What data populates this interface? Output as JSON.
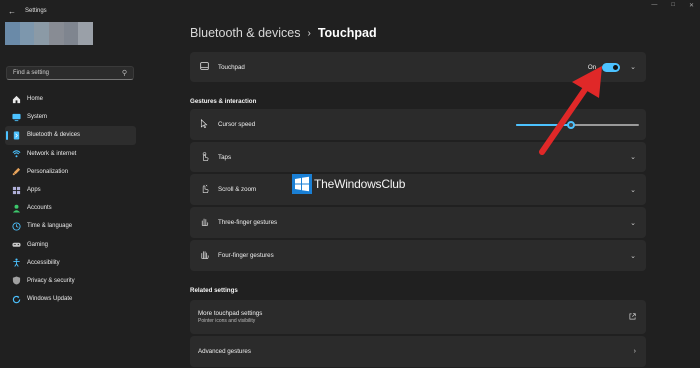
{
  "app": {
    "title": "Settings",
    "back_icon": "arrow-left-icon",
    "window_controls": [
      "minimize-icon",
      "maximize-icon",
      "close-icon"
    ]
  },
  "search": {
    "placeholder": "Find a setting",
    "icon": "search-icon"
  },
  "sidebar": {
    "items": [
      {
        "label": "Home",
        "icon": "home-icon",
        "active": false,
        "color": "#e8e8e8"
      },
      {
        "label": "System",
        "icon": "monitor-icon",
        "active": false,
        "color": "#4cc2ff"
      },
      {
        "label": "Bluetooth & devices",
        "icon": "bluetooth-icon",
        "active": true,
        "color": "#4cc2ff"
      },
      {
        "label": "Network & internet",
        "icon": "wifi-icon",
        "active": false,
        "color": "#4cc2ff"
      },
      {
        "label": "Personalization",
        "icon": "brush-icon",
        "active": false,
        "color": "#e8a45c"
      },
      {
        "label": "Apps",
        "icon": "apps-icon",
        "active": false,
        "color": "#b0b0d8"
      },
      {
        "label": "Accounts",
        "icon": "person-icon",
        "active": false,
        "color": "#3cc86c"
      },
      {
        "label": "Time & language",
        "icon": "globe-clock-icon",
        "active": false,
        "color": "#4cc2ff"
      },
      {
        "label": "Gaming",
        "icon": "gamepad-icon",
        "active": false,
        "color": "#c8c8c8"
      },
      {
        "label": "Accessibility",
        "icon": "accessibility-icon",
        "active": false,
        "color": "#4cc2ff"
      },
      {
        "label": "Privacy & security",
        "icon": "shield-icon",
        "active": false,
        "color": "#a0a0a0"
      },
      {
        "label": "Windows Update",
        "icon": "refresh-icon",
        "active": false,
        "color": "#4cc2ff"
      }
    ]
  },
  "breadcrumb": {
    "parent": "Bluetooth & devices",
    "separator": "›",
    "current": "Touchpad"
  },
  "touchpad": {
    "label": "Touchpad",
    "icon": "touchpad-icon",
    "state": "On",
    "enabled": true
  },
  "gestures_section": {
    "heading": "Gestures & interaction",
    "cursor_speed": {
      "label": "Cursor speed",
      "icon": "cursor-icon",
      "value_fraction": 0.45
    },
    "rows": [
      {
        "label": "Taps",
        "icon": "tap-icon"
      },
      {
        "label": "Scroll & zoom",
        "icon": "scroll-zoom-icon"
      },
      {
        "label": "Three-finger gestures",
        "icon": "three-finger-icon"
      },
      {
        "label": "Four-finger gestures",
        "icon": "four-finger-icon"
      }
    ]
  },
  "related_section": {
    "heading": "Related settings",
    "more": {
      "label": "More touchpad settings",
      "sublabel": "Pointer icons and visibility",
      "icon": "external-link-icon"
    },
    "advanced": {
      "label": "Advanced gestures",
      "icon": "chevron-right-icon"
    }
  },
  "watermark": {
    "text": "TheWindowsClub"
  },
  "colors": {
    "accent": "#4cc2ff",
    "background": "#202020",
    "card": "#2b2b2b",
    "arrow": "#e02828"
  }
}
